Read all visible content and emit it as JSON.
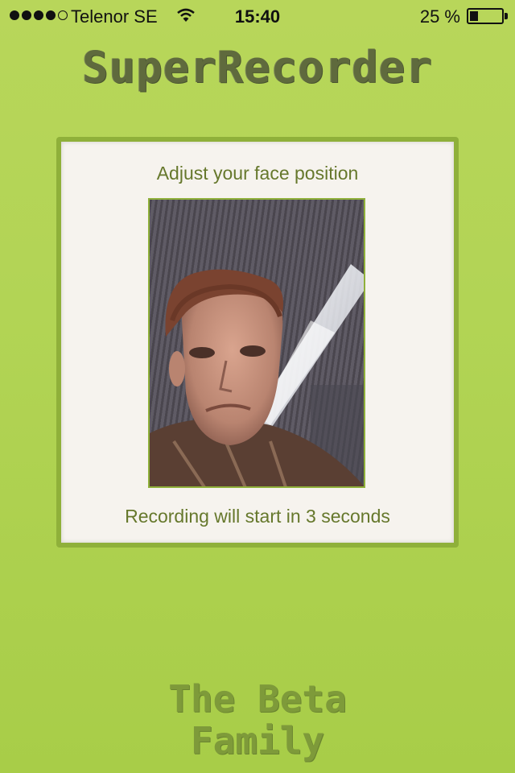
{
  "status_bar": {
    "carrier": "Telenor SE",
    "time": "15:40",
    "battery_percent": "25 %",
    "battery_level": 0.25,
    "signal_bars_filled": 4,
    "signal_bars_total": 5
  },
  "app": {
    "title": "SuperRecorder"
  },
  "card": {
    "heading": "Adjust your face position",
    "countdown_text": "Recording will start in 3 seconds"
  },
  "footer": {
    "logo_line1": "The Beta",
    "logo_line2": "Family"
  },
  "colors": {
    "background": "#b2d455",
    "card_border": "#8fb03a",
    "card_text": "#66782c",
    "title_text": "#5f6a3d"
  },
  "icons": {
    "wifi": "wifi-icon",
    "battery": "battery-icon"
  }
}
